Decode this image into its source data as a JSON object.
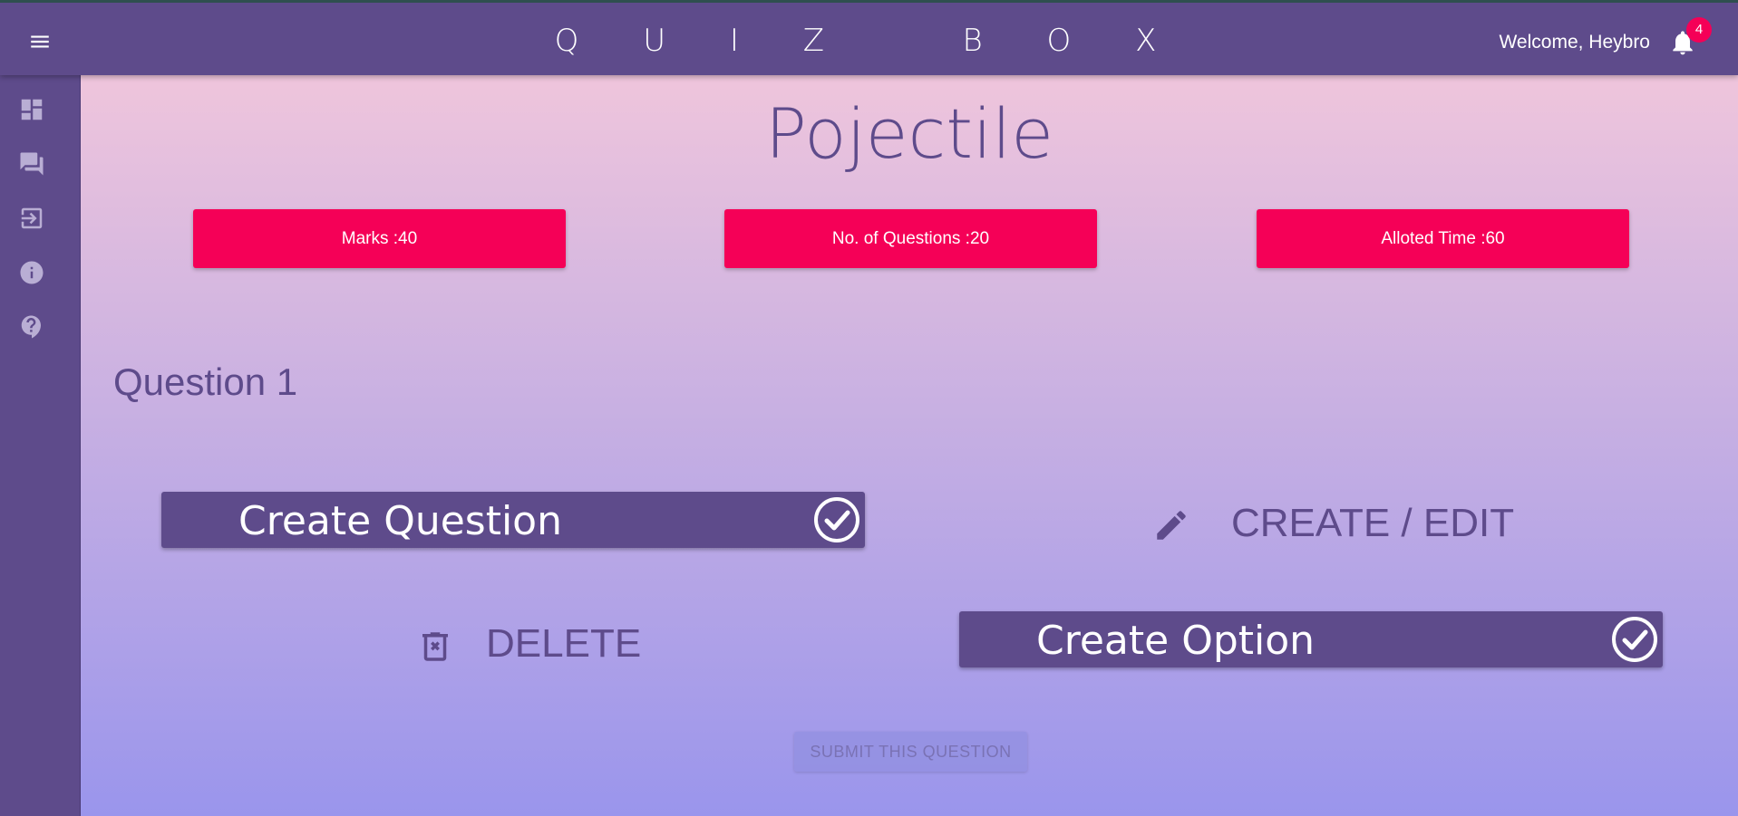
{
  "header": {
    "brand": "Q U I Z   B O X",
    "welcome": "Welcome, Heybro",
    "notification_count": "4"
  },
  "sidebar": {
    "items": [
      {
        "icon": "dashboard-icon"
      },
      {
        "icon": "forum-icon"
      },
      {
        "icon": "exit-icon"
      },
      {
        "icon": "info-icon"
      },
      {
        "icon": "help-icon"
      }
    ]
  },
  "quiz": {
    "title": "Pojectile",
    "marks": "Marks :40",
    "questions": "No. of Questions :20",
    "time": "Alloted Time :60"
  },
  "question": {
    "label": "Question 1",
    "create_question": "Create Question",
    "create_edit": "CREATE / EDIT",
    "delete": "DELETE",
    "create_option": "Create Option",
    "submit": "SUBMIT THIS QUESTION"
  },
  "colors": {
    "primary": "#5e4b8b",
    "accent": "#f50057"
  }
}
